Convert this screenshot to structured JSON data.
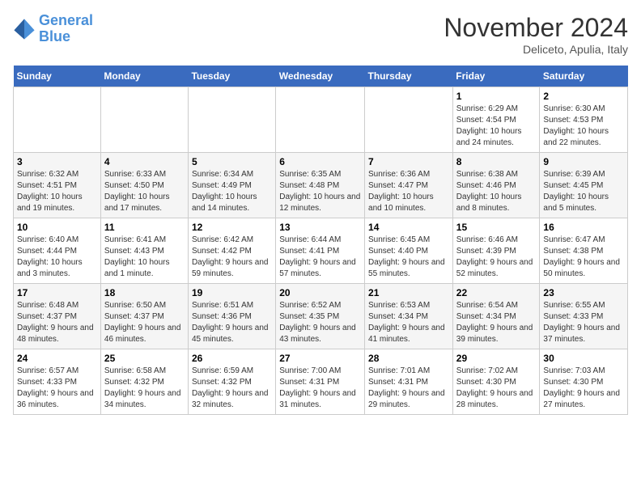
{
  "header": {
    "logo_line1": "General",
    "logo_line2": "Blue",
    "month": "November 2024",
    "location": "Deliceto, Apulia, Italy"
  },
  "days_of_week": [
    "Sunday",
    "Monday",
    "Tuesday",
    "Wednesday",
    "Thursday",
    "Friday",
    "Saturday"
  ],
  "weeks": [
    [
      {
        "day": "",
        "info": ""
      },
      {
        "day": "",
        "info": ""
      },
      {
        "day": "",
        "info": ""
      },
      {
        "day": "",
        "info": ""
      },
      {
        "day": "",
        "info": ""
      },
      {
        "day": "1",
        "info": "Sunrise: 6:29 AM\nSunset: 4:54 PM\nDaylight: 10 hours and 24 minutes."
      },
      {
        "day": "2",
        "info": "Sunrise: 6:30 AM\nSunset: 4:53 PM\nDaylight: 10 hours and 22 minutes."
      }
    ],
    [
      {
        "day": "3",
        "info": "Sunrise: 6:32 AM\nSunset: 4:51 PM\nDaylight: 10 hours and 19 minutes."
      },
      {
        "day": "4",
        "info": "Sunrise: 6:33 AM\nSunset: 4:50 PM\nDaylight: 10 hours and 17 minutes."
      },
      {
        "day": "5",
        "info": "Sunrise: 6:34 AM\nSunset: 4:49 PM\nDaylight: 10 hours and 14 minutes."
      },
      {
        "day": "6",
        "info": "Sunrise: 6:35 AM\nSunset: 4:48 PM\nDaylight: 10 hours and 12 minutes."
      },
      {
        "day": "7",
        "info": "Sunrise: 6:36 AM\nSunset: 4:47 PM\nDaylight: 10 hours and 10 minutes."
      },
      {
        "day": "8",
        "info": "Sunrise: 6:38 AM\nSunset: 4:46 PM\nDaylight: 10 hours and 8 minutes."
      },
      {
        "day": "9",
        "info": "Sunrise: 6:39 AM\nSunset: 4:45 PM\nDaylight: 10 hours and 5 minutes."
      }
    ],
    [
      {
        "day": "10",
        "info": "Sunrise: 6:40 AM\nSunset: 4:44 PM\nDaylight: 10 hours and 3 minutes."
      },
      {
        "day": "11",
        "info": "Sunrise: 6:41 AM\nSunset: 4:43 PM\nDaylight: 10 hours and 1 minute."
      },
      {
        "day": "12",
        "info": "Sunrise: 6:42 AM\nSunset: 4:42 PM\nDaylight: 9 hours and 59 minutes."
      },
      {
        "day": "13",
        "info": "Sunrise: 6:44 AM\nSunset: 4:41 PM\nDaylight: 9 hours and 57 minutes."
      },
      {
        "day": "14",
        "info": "Sunrise: 6:45 AM\nSunset: 4:40 PM\nDaylight: 9 hours and 55 minutes."
      },
      {
        "day": "15",
        "info": "Sunrise: 6:46 AM\nSunset: 4:39 PM\nDaylight: 9 hours and 52 minutes."
      },
      {
        "day": "16",
        "info": "Sunrise: 6:47 AM\nSunset: 4:38 PM\nDaylight: 9 hours and 50 minutes."
      }
    ],
    [
      {
        "day": "17",
        "info": "Sunrise: 6:48 AM\nSunset: 4:37 PM\nDaylight: 9 hours and 48 minutes."
      },
      {
        "day": "18",
        "info": "Sunrise: 6:50 AM\nSunset: 4:37 PM\nDaylight: 9 hours and 46 minutes."
      },
      {
        "day": "19",
        "info": "Sunrise: 6:51 AM\nSunset: 4:36 PM\nDaylight: 9 hours and 45 minutes."
      },
      {
        "day": "20",
        "info": "Sunrise: 6:52 AM\nSunset: 4:35 PM\nDaylight: 9 hours and 43 minutes."
      },
      {
        "day": "21",
        "info": "Sunrise: 6:53 AM\nSunset: 4:34 PM\nDaylight: 9 hours and 41 minutes."
      },
      {
        "day": "22",
        "info": "Sunrise: 6:54 AM\nSunset: 4:34 PM\nDaylight: 9 hours and 39 minutes."
      },
      {
        "day": "23",
        "info": "Sunrise: 6:55 AM\nSunset: 4:33 PM\nDaylight: 9 hours and 37 minutes."
      }
    ],
    [
      {
        "day": "24",
        "info": "Sunrise: 6:57 AM\nSunset: 4:33 PM\nDaylight: 9 hours and 36 minutes."
      },
      {
        "day": "25",
        "info": "Sunrise: 6:58 AM\nSunset: 4:32 PM\nDaylight: 9 hours and 34 minutes."
      },
      {
        "day": "26",
        "info": "Sunrise: 6:59 AM\nSunset: 4:32 PM\nDaylight: 9 hours and 32 minutes."
      },
      {
        "day": "27",
        "info": "Sunrise: 7:00 AM\nSunset: 4:31 PM\nDaylight: 9 hours and 31 minutes."
      },
      {
        "day": "28",
        "info": "Sunrise: 7:01 AM\nSunset: 4:31 PM\nDaylight: 9 hours and 29 minutes."
      },
      {
        "day": "29",
        "info": "Sunrise: 7:02 AM\nSunset: 4:30 PM\nDaylight: 9 hours and 28 minutes."
      },
      {
        "day": "30",
        "info": "Sunrise: 7:03 AM\nSunset: 4:30 PM\nDaylight: 9 hours and 27 minutes."
      }
    ]
  ]
}
